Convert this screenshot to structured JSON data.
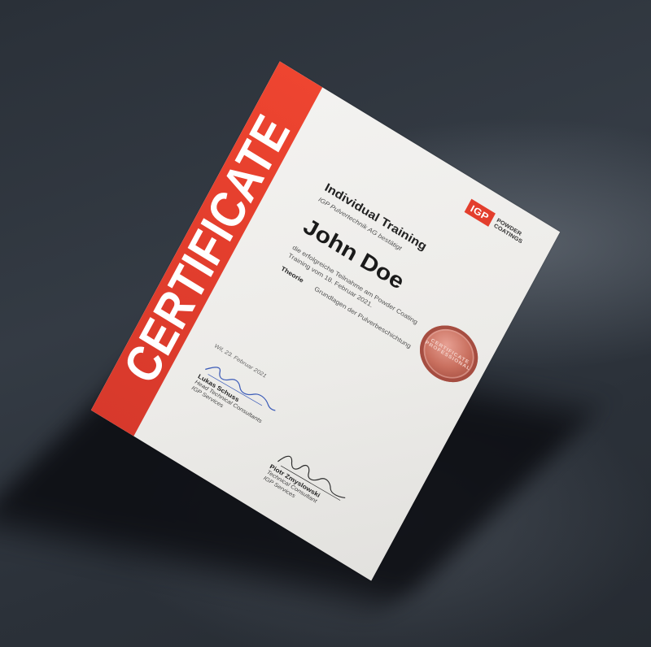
{
  "certificate": {
    "band_word": "CERTIFICATE",
    "logo": {
      "mark": "IGP",
      "line1": "POWDER",
      "line2": "COATINGS"
    },
    "title": "Individual Training",
    "confirmation": "IGP Pulvertechnik AG bestätigt",
    "recipient": "John Doe",
    "body_line1": "die erfolgreiche Teilnahme am Powder Coating",
    "body_line2": "Training vom 18. Februar 2021.",
    "topic_label": "Theorie",
    "topic_text": "Grundlagen der Pulverbeschichtung",
    "seal_text": "CERTIFICATE PROFESSIONAL",
    "place_date": "Wil, 23. Februar 2021",
    "signers": [
      {
        "name": "Lukas Schuss",
        "role1": "Head Technical Consultants",
        "role2": "IGP Services"
      },
      {
        "name": "Piotr Zmyslowski",
        "role1": "Technical Consultant",
        "role2": "IGP Services"
      }
    ]
  },
  "colors": {
    "accent_red": "#e33e2d",
    "background": "#2e343c",
    "paper": "#f1f0ee"
  }
}
